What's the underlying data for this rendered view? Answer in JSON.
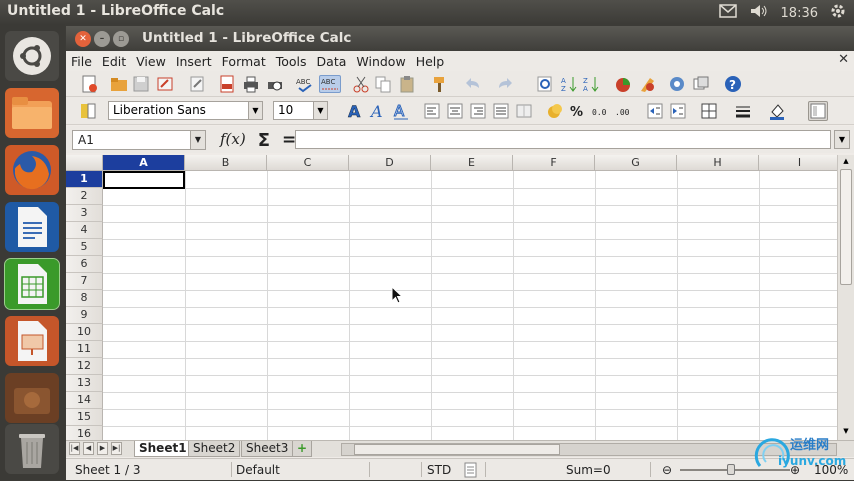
{
  "topbar": {
    "title": "Untitled 1 - LibreOffice Calc",
    "time": "18:36"
  },
  "launcher": {
    "items": [
      "ubuntu-home",
      "files",
      "firefox",
      "writer",
      "calc",
      "impress",
      "software",
      "trash"
    ]
  },
  "window": {
    "title": "Untitled 1 - LibreOffice Calc"
  },
  "menubar": {
    "items": [
      "File",
      "Edit",
      "View",
      "Insert",
      "Format",
      "Tools",
      "Data",
      "Window",
      "Help"
    ]
  },
  "format": {
    "font_name": "Liberation Sans",
    "font_size": "10"
  },
  "formula": {
    "cell_ref": "A1",
    "fx": "f(x)",
    "sum": "Σ",
    "equals": "=",
    "content": ""
  },
  "grid": {
    "columns": [
      "A",
      "B",
      "C",
      "D",
      "E",
      "F",
      "G",
      "H",
      "I"
    ],
    "rows": [
      "1",
      "2",
      "3",
      "4",
      "5",
      "6",
      "7",
      "8",
      "9",
      "10",
      "11",
      "12",
      "13",
      "14",
      "15",
      "16"
    ],
    "selected_cell": "A1"
  },
  "tabs": {
    "sheets": [
      "Sheet1",
      "Sheet2",
      "Sheet3"
    ],
    "active": "Sheet1",
    "add": "+"
  },
  "status": {
    "sheet": "Sheet 1 / 3",
    "style": "Default",
    "mode": "STD",
    "sum": "Sum=0",
    "zoom": "100%"
  },
  "watermark": {
    "text": "运维网",
    "url": "iyunv.com"
  },
  "colors": {
    "accent": "#1c3e9e",
    "calc_green": "#3a9a2a",
    "launcher_bg": "#3b3a36"
  }
}
